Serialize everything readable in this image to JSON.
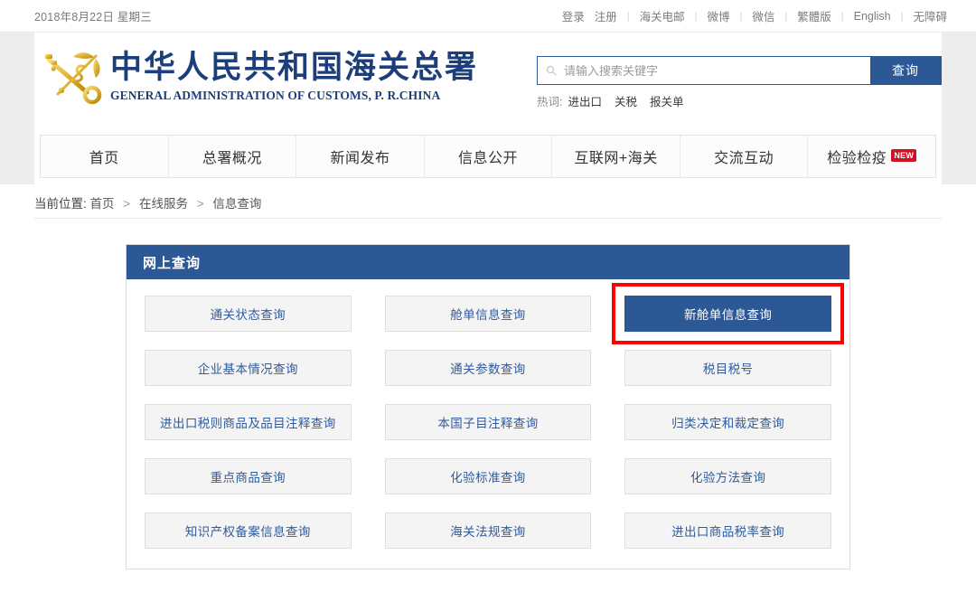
{
  "topbar": {
    "date": "2018年8月22日 星期三",
    "links": [
      {
        "label": "登录",
        "icon": "login-icon"
      },
      {
        "label": "注册",
        "icon": "register-icon"
      },
      {
        "label": "海关电邮",
        "icon": "mail-icon"
      },
      {
        "label": "微博",
        "icon": "weibo-icon"
      },
      {
        "label": "微信",
        "icon": "wechat-icon"
      },
      {
        "label": "繁體版",
        "icon": "traditional-chinese-icon"
      },
      {
        "label": "English",
        "icon": "english-icon"
      },
      {
        "label": "无障碍",
        "icon": "accessibility-icon"
      }
    ]
  },
  "brand": {
    "title_cn": "中华人民共和国海关总署",
    "title_en": "GENERAL ADMINISTRATION OF CUSTOMS, P. R.CHINA",
    "emblem_icon": "customs-key-caduceus-emblem"
  },
  "search": {
    "placeholder": "请输入搜索关键字",
    "value": "",
    "button_label": "查询",
    "search_icon": "search-icon",
    "hotwords_label": "热词:",
    "hotwords": [
      "进出口",
      "关税",
      "报关单"
    ]
  },
  "nav": {
    "items": [
      {
        "label": "首页",
        "badge": ""
      },
      {
        "label": "总署概况",
        "badge": ""
      },
      {
        "label": "新闻发布",
        "badge": ""
      },
      {
        "label": "信息公开",
        "badge": ""
      },
      {
        "label": "互联网+海关",
        "badge": ""
      },
      {
        "label": "交流互动",
        "badge": ""
      },
      {
        "label": "检验检疫",
        "badge": "NEW"
      }
    ]
  },
  "breadcrumb": {
    "label": "当前位置:",
    "items": [
      "首页",
      "在线服务",
      "信息查询"
    ],
    "separator": ">"
  },
  "panel": {
    "title": "网上查询",
    "buttons": [
      {
        "label": "通关状态查询",
        "active": false
      },
      {
        "label": "舱单信息查询",
        "active": false
      },
      {
        "label": "新舱单信息查询",
        "active": true,
        "highlighted": true
      },
      {
        "label": "企业基本情况查询",
        "active": false
      },
      {
        "label": "通关参数查询",
        "active": false
      },
      {
        "label": "税目税号",
        "active": false
      },
      {
        "label": "进出口税则商品及品目注释查询",
        "active": false
      },
      {
        "label": "本国子目注释查询",
        "active": false
      },
      {
        "label": "归类决定和裁定查询",
        "active": false
      },
      {
        "label": "重点商品查询",
        "active": false
      },
      {
        "label": "化验标准查询",
        "active": false
      },
      {
        "label": "化验方法查询",
        "active": false
      },
      {
        "label": "知识产权备案信息查询",
        "active": false
      },
      {
        "label": "海关法规查询",
        "active": false
      },
      {
        "label": "进出口商品税率查询",
        "active": false
      }
    ]
  },
  "colors": {
    "brand_blue": "#2d5896",
    "badge_red": "#cf1322",
    "annotation_red": "#ff0000",
    "button_bg": "#f4f4f4",
    "header_gutter": "#ededed"
  }
}
